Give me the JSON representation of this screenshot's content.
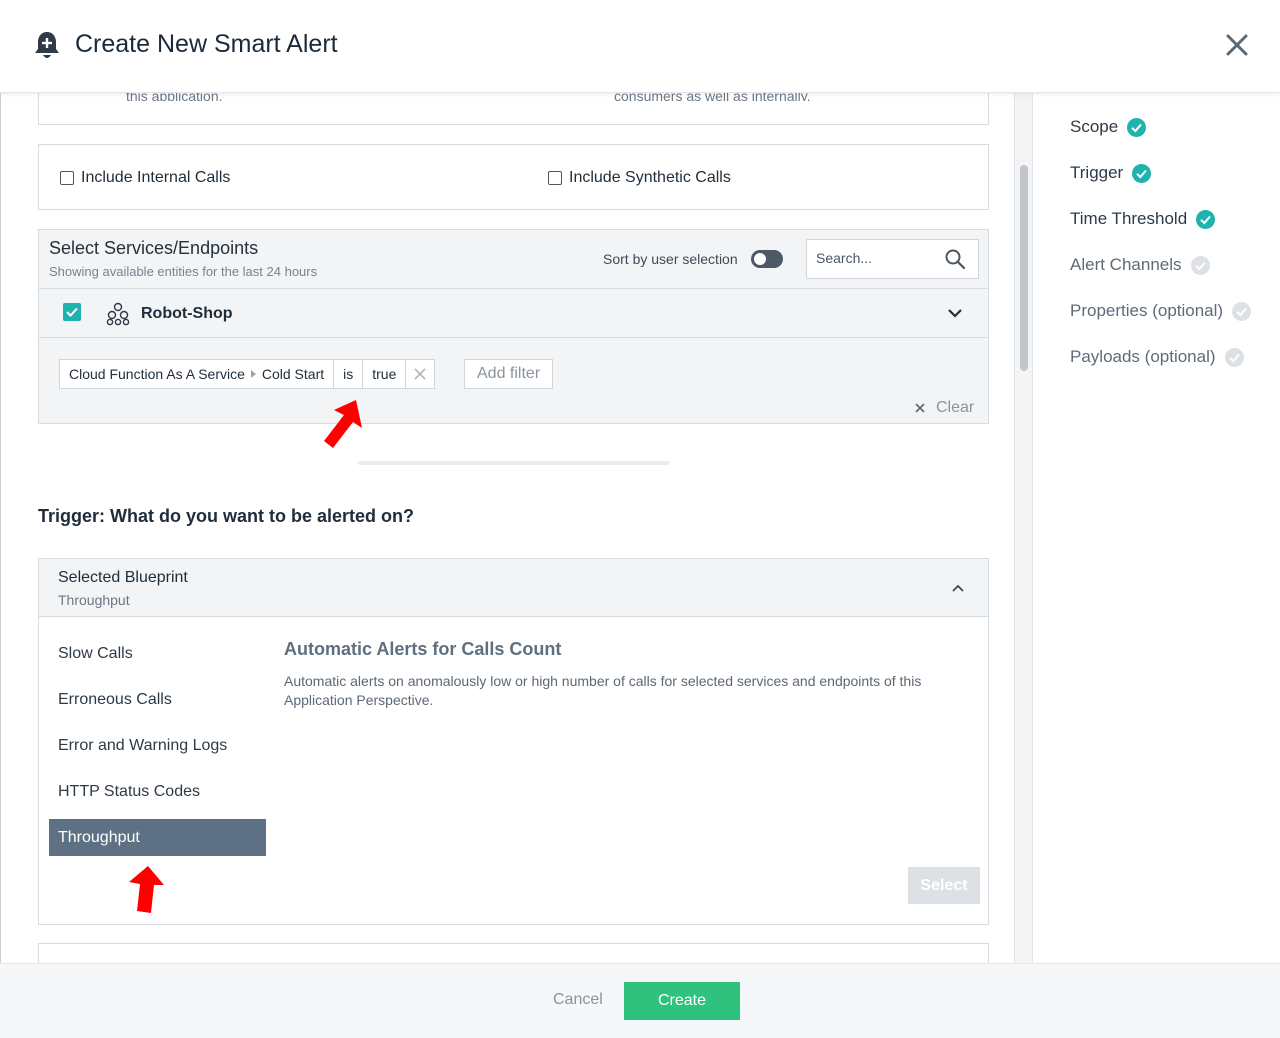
{
  "header": {
    "title": "Create New Smart Alert",
    "icon": "bell-plus-icon"
  },
  "scope_section": {
    "cut_text_left": "this application.",
    "cut_text_right": "consumers as well as internally.",
    "include_internal_label": "Include Internal Calls",
    "include_synthetic_label": "Include Synthetic Calls",
    "services": {
      "title": "Select Services/Endpoints",
      "subtitle": "Showing available entities for the last 24 hours",
      "sort_label": "Sort by user selection",
      "search_placeholder": "Search...",
      "app_name": "Robot-Shop",
      "filter": {
        "entity": "Cloud Function As A Service",
        "attribute": "Cold Start",
        "operator": "is",
        "value": "true"
      },
      "add_filter_label": "Add filter",
      "clear_label": "Clear"
    }
  },
  "trigger": {
    "heading": "Trigger: What do you want to be alerted on?",
    "blueprint_title": "Selected Blueprint",
    "blueprint_selected": "Throughput",
    "items": [
      "Slow Calls",
      "Erroneous Calls",
      "Error and Warning Logs",
      "HTTP Status Codes",
      "Throughput"
    ],
    "active_index": 4,
    "description_title": "Automatic Alerts for Calls Count",
    "description_text": "Automatic alerts on anomalously low or high number of calls for selected services and endpoints of this Application Perspective.",
    "select_label": "Select"
  },
  "steps": [
    {
      "label": "Scope",
      "done": true
    },
    {
      "label": "Trigger",
      "done": true
    },
    {
      "label": "Time Threshold",
      "done": true
    },
    {
      "label": "Alert Channels",
      "done": false
    },
    {
      "label": "Properties (optional)",
      "done": false
    },
    {
      "label": "Payloads (optional)",
      "done": false
    }
  ],
  "footer": {
    "cancel_label": "Cancel",
    "create_label": "Create"
  },
  "colors": {
    "accent_teal": "#1fb3b0",
    "create_green": "#2ec27e",
    "active_item": "#5e7184",
    "annotation_red": "#ff0000"
  }
}
